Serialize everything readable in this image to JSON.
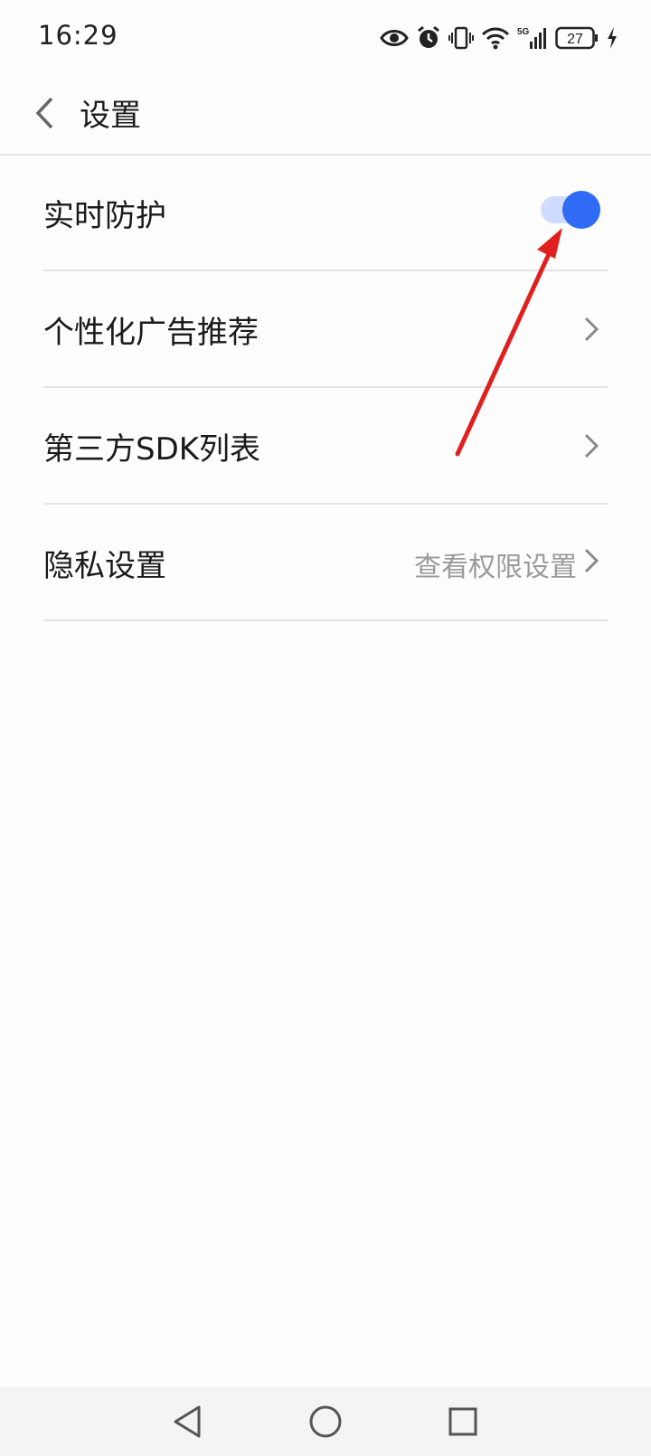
{
  "status_bar": {
    "time": "16:29",
    "network": "5G",
    "battery": "27",
    "icons": [
      "eye-icon",
      "alarm-icon",
      "vibrate-icon",
      "wifi-icon",
      "signal-5g-icon",
      "battery-icon",
      "charging-icon"
    ]
  },
  "app_bar": {
    "title": "设置",
    "back_icon": "chevron-left-icon"
  },
  "settings": {
    "items": [
      {
        "label": "实时防护",
        "type": "toggle",
        "on": true
      },
      {
        "label": "个性化广告推荐",
        "type": "link"
      },
      {
        "label": "第三方SDK列表",
        "type": "link"
      },
      {
        "label": "隐私设置",
        "type": "link",
        "value": "查看权限设置"
      }
    ]
  },
  "annotation": {
    "arrow_color": "#e0201e"
  },
  "colors": {
    "accent": "#2f6bf5",
    "toggle_track": "#cfdcff"
  },
  "nav_bar": {
    "icons": [
      "back-triangle-icon",
      "home-circle-icon",
      "recents-square-icon"
    ]
  }
}
